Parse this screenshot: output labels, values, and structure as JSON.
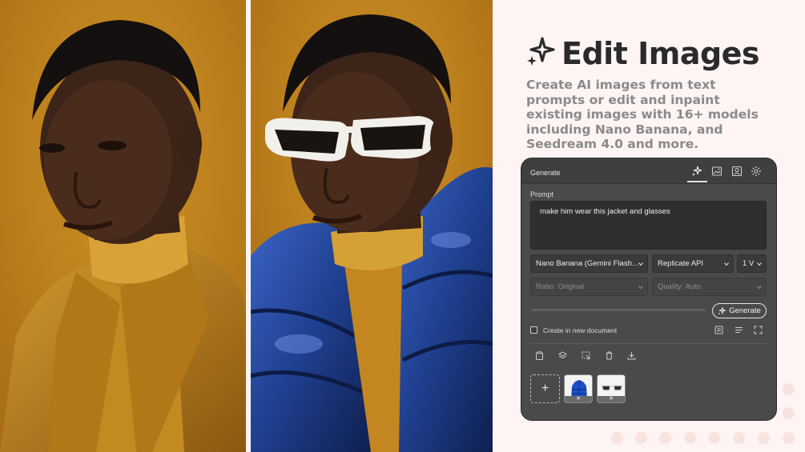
{
  "marketing": {
    "title": "Edit Images",
    "subtitle": "Create AI images from text prompts or edit and inpaint existing images with 16+ models including Nano Banana, and Seedream 4.0 and more."
  },
  "panel": {
    "header_title": "Generate",
    "header_tabs": [
      "sparkle-icon",
      "image-edit-icon",
      "portrait-icon",
      "gear-icon"
    ],
    "prompt_label": "Prompt",
    "prompt_value": "make him wear this jacket and glasses",
    "model_select": "Nano Banana (Gemini Flash...",
    "provider_select": "Replicate API",
    "version_select": "1 V",
    "ratio_select": "Ratio: Original",
    "quality_select": "Quality: Auto",
    "generate_label": "Generate",
    "create_new_doc_label": "Create in new document",
    "create_new_doc_checked": false,
    "toolbar_icons": [
      "clipboard-icon",
      "layers-icon",
      "select-icon",
      "trash-icon",
      "download-icon"
    ],
    "reference_images": [
      "blue-puffer-jacket",
      "white-sunglasses"
    ],
    "add_reference_label": "+"
  },
  "colors": {
    "page_bg": "#fdf4f3",
    "panel_bg": "#4a4a4a",
    "photo_bg": "#c08220",
    "jacket_blue": "#1f3f8f"
  }
}
